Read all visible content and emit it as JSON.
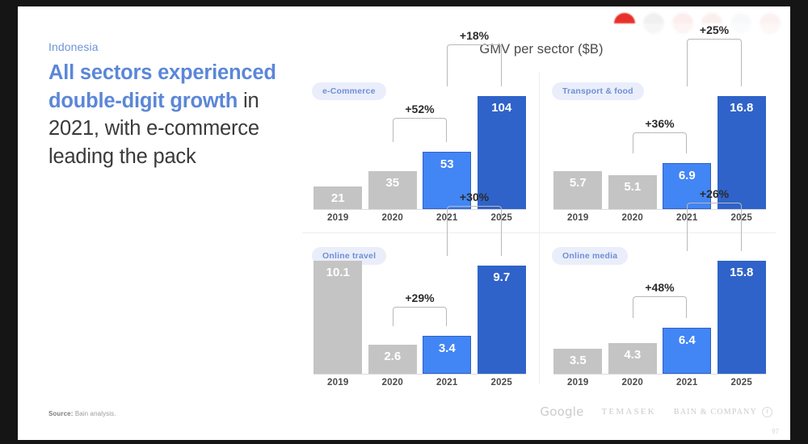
{
  "slide": {
    "eyebrow": "Indonesia",
    "headline_highlight": "All sectors experienced double-digit growth",
    "headline_rest": " in 2021, with e-commerce leading the pack",
    "panel_title": "GMV per sector ($B)",
    "source": "Source:",
    "source_text": " Bain analysis.",
    "page_number": "97"
  },
  "flags": [
    {
      "name": "indonesia-flag",
      "top": "#e8302a",
      "bottom": "#ffffff",
      "state": "active"
    },
    {
      "name": "malaysia-flag",
      "top": "#cfcfcf",
      "bottom": "#e4e4e4",
      "state": "dim"
    },
    {
      "name": "philippines-flag",
      "top": "#f2c9c6",
      "bottom": "#fadedd",
      "state": "dim"
    },
    {
      "name": "singapore-flag",
      "top": "#f0b9b5",
      "bottom": "#ffffff",
      "state": "dim2"
    },
    {
      "name": "thailand-flag",
      "top": "#dfe3ea",
      "bottom": "#eef0f4",
      "state": "dim2"
    },
    {
      "name": "vietnam-flag",
      "top": "#f3c4c1",
      "bottom": "#f8dcda",
      "state": "dim2"
    }
  ],
  "logos": {
    "google": "Google",
    "temasek": "TEMASEK",
    "bain": "BAIN & COMPANY"
  },
  "colors": {
    "gray_bar": "#c4c4c4",
    "blue_bar": "#4285f4",
    "dark_blue_bar": "#2f63c9",
    "accent_text": "#5b87d8",
    "pill_bg": "#eaeefb"
  },
  "chart_data": [
    {
      "type": "bar",
      "title": "e-Commerce",
      "categories": [
        "2019",
        "2020",
        "2021",
        "2025"
      ],
      "values": [
        21,
        35,
        53,
        104
      ],
      "value_labels": [
        "21",
        "35",
        "53",
        "104"
      ],
      "bar_styles": [
        "gray",
        "gray",
        "blue",
        "dblue"
      ],
      "ylabel": "GMV ($B)",
      "ylim": [
        0,
        104
      ],
      "annotations": [
        {
          "label": "+52%",
          "from": "2020",
          "to": "2021"
        },
        {
          "label": "+18%",
          "from": "2021",
          "to": "2025"
        }
      ]
    },
    {
      "type": "bar",
      "title": "Transport & food",
      "categories": [
        "2019",
        "2020",
        "2021",
        "2025"
      ],
      "values": [
        5.7,
        5.1,
        6.9,
        16.8
      ],
      "value_labels": [
        "5.7",
        "5.1",
        "6.9",
        "16.8"
      ],
      "bar_styles": [
        "gray",
        "gray",
        "blue",
        "dblue"
      ],
      "ylabel": "GMV ($B)",
      "ylim": [
        0,
        16.8
      ],
      "annotations": [
        {
          "label": "+36%",
          "from": "2020",
          "to": "2021"
        },
        {
          "label": "+25%",
          "from": "2021",
          "to": "2025"
        }
      ]
    },
    {
      "type": "bar",
      "title": "Online travel",
      "categories": [
        "2019",
        "2020",
        "2021",
        "2025"
      ],
      "values": [
        10.1,
        2.6,
        3.4,
        9.7
      ],
      "value_labels": [
        "10.1",
        "2.6",
        "3.4",
        "9.7"
      ],
      "bar_styles": [
        "gray",
        "gray",
        "blue",
        "dblue"
      ],
      "ylabel": "GMV ($B)",
      "ylim": [
        0,
        10.1
      ],
      "annotations": [
        {
          "label": "+29%",
          "from": "2020",
          "to": "2021"
        },
        {
          "label": "+30%",
          "from": "2021",
          "to": "2025"
        }
      ]
    },
    {
      "type": "bar",
      "title": "Online media",
      "categories": [
        "2019",
        "2020",
        "2021",
        "2025"
      ],
      "values": [
        3.5,
        4.3,
        6.4,
        15.8
      ],
      "value_labels": [
        "3.5",
        "4.3",
        "6.4",
        "15.8"
      ],
      "bar_styles": [
        "gray",
        "gray",
        "blue",
        "dblue"
      ],
      "ylabel": "GMV ($B)",
      "ylim": [
        0,
        15.8
      ],
      "annotations": [
        {
          "label": "+48%",
          "from": "2020",
          "to": "2021"
        },
        {
          "label": "+26%",
          "from": "2021",
          "to": "2025"
        }
      ]
    }
  ]
}
